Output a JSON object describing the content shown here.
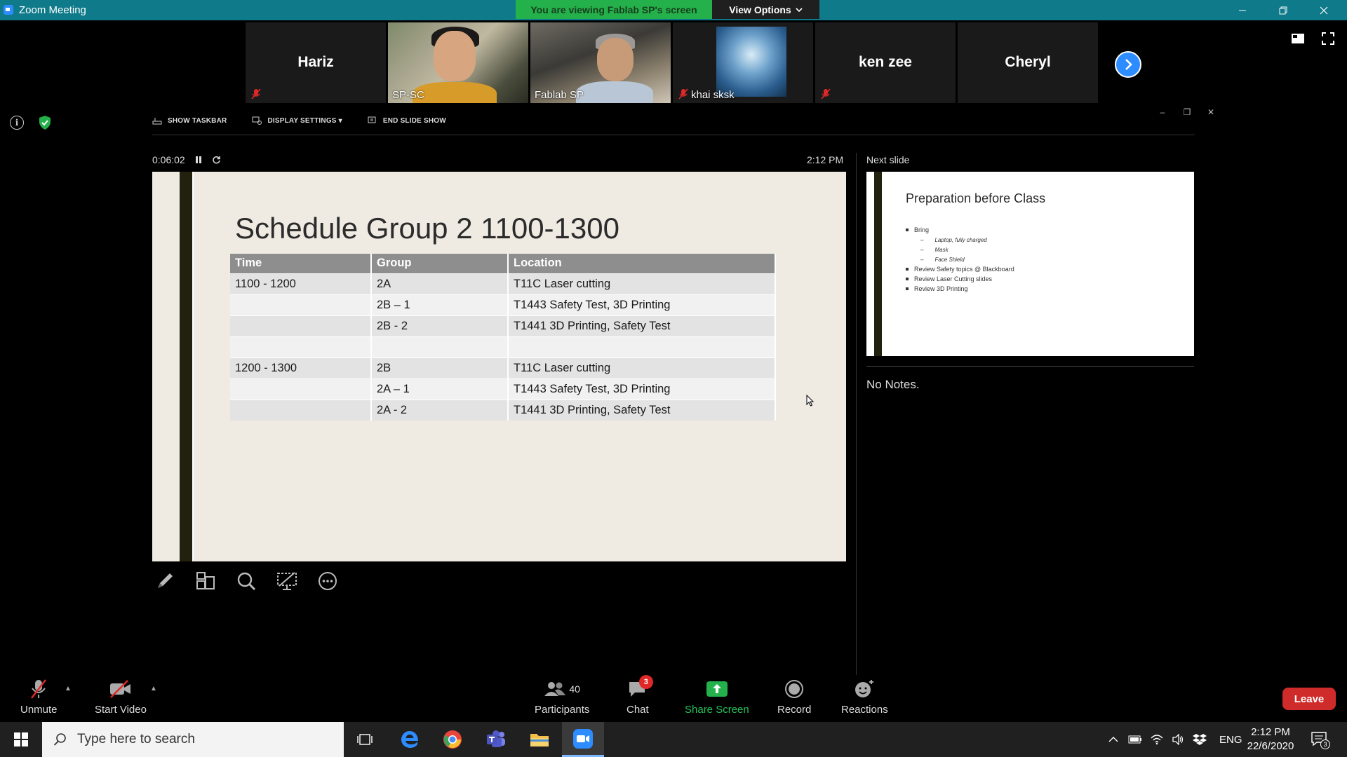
{
  "window": {
    "title": "Zoom Meeting",
    "viewing_banner": "You are viewing Fablab SP's screen",
    "view_options": "View Options"
  },
  "participants_strip": [
    {
      "name": "Hariz",
      "video": false,
      "muted": true
    },
    {
      "name": "SP-SC",
      "video": true,
      "muted": false,
      "active_speaker": true
    },
    {
      "name": "Fablab SP",
      "video": true,
      "muted": false
    },
    {
      "name": "khai sksk",
      "video": false,
      "muted": true,
      "avatar": true
    },
    {
      "name": "ken zee",
      "video": false,
      "muted": true
    },
    {
      "name": "Cheryl",
      "video": false,
      "muted": false
    }
  ],
  "presenter_toolbar": {
    "show_taskbar": "SHOW TASKBAR",
    "display_settings": "DISPLAY SETTINGS ▾",
    "end_slide_show": "END SLIDE SHOW"
  },
  "presenter": {
    "elapsed": "0:06:02",
    "clock": "2:12 PM",
    "next_slide_label": "Next slide",
    "notes": "No Notes."
  },
  "slide": {
    "title": "Schedule Group 2 1100-1300",
    "headers": [
      "Time",
      "Group",
      "Location"
    ],
    "rows": [
      [
        "1100 - 1200",
        "2A",
        "T11C Laser cutting"
      ],
      [
        "",
        "2B – 1",
        "T1443 Safety Test, 3D Printing"
      ],
      [
        "",
        "2B - 2",
        "T1441 3D Printing, Safety Test"
      ],
      [
        "",
        "",
        ""
      ],
      [
        "1200 - 1300",
        "2B",
        "T11C Laser cutting"
      ],
      [
        "",
        "2A – 1",
        "T1443 Safety Test, 3D Printing"
      ],
      [
        "",
        "2A - 2",
        "T1441 3D Printing, Safety Test"
      ]
    ]
  },
  "next_slide": {
    "title": "Preparation before Class",
    "bullets": [
      {
        "text": "Bring",
        "level": 1
      },
      {
        "text": "Laptop, fully charged",
        "level": 2
      },
      {
        "text": "Mask",
        "level": 2
      },
      {
        "text": "Face Shield",
        "level": 2
      },
      {
        "text": "Review Safety topics @ Blackboard",
        "level": 1
      },
      {
        "text": "Review Laser Cutting slides",
        "level": 1
      },
      {
        "text": "Review 3D Printing",
        "level": 1
      }
    ]
  },
  "slide_tools": [
    "pen-icon",
    "slides-grid-icon",
    "zoom-icon",
    "black-screen-icon",
    "more-icon"
  ],
  "meeting_toolbar": {
    "unmute": "Unmute",
    "start_video": "Start Video",
    "participants": "Participants",
    "participants_count": "40",
    "chat": "Chat",
    "chat_badge": "3",
    "share_screen": "Share Screen",
    "record": "Record",
    "reactions": "Reactions",
    "leave": "Leave"
  },
  "taskbar": {
    "search_placeholder": "Type here to search",
    "lang": "ENG",
    "time": "2:12 PM",
    "date": "22/6/2020",
    "notification_count": "3"
  },
  "colors": {
    "zoom_blue": "#2d8cff",
    "banner_green": "#24b04b",
    "leave_red": "#d02b2b",
    "titlebar": "#0f7a8a"
  }
}
